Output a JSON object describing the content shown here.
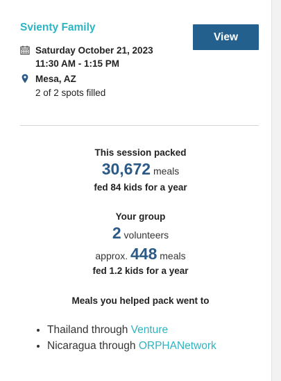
{
  "event": {
    "group_name": "Svienty Family",
    "view_button": "View",
    "date": "Saturday October 21, 2023",
    "time": "11:30 AM - 1:15 PM",
    "location": "Mesa, AZ",
    "spots": "2 of 2 spots filled",
    "icons": [
      "calendar-icon",
      "map-pin-icon"
    ]
  },
  "session": {
    "label": "This session packed",
    "meals_count": "30,672",
    "meals_unit": "meals",
    "fed": "fed 84 kids for a year"
  },
  "group": {
    "label": "Your group",
    "volunteers_count": "2",
    "volunteers_unit": "volunteers",
    "approx_prefix": "approx.",
    "approx_meals": "448",
    "approx_unit": "meals",
    "fed": "fed 1.2 kids for a year"
  },
  "destinations": {
    "heading": "Meals you helped pack went to",
    "items": [
      {
        "place": "Thailand through",
        "org": "Venture"
      },
      {
        "place": "Nicaragua through",
        "org": "ORPHANetwork"
      }
    ]
  },
  "colors": {
    "accent_teal": "#2db4c2",
    "button_blue": "#24608e",
    "number_blue": "#2a5a85"
  }
}
